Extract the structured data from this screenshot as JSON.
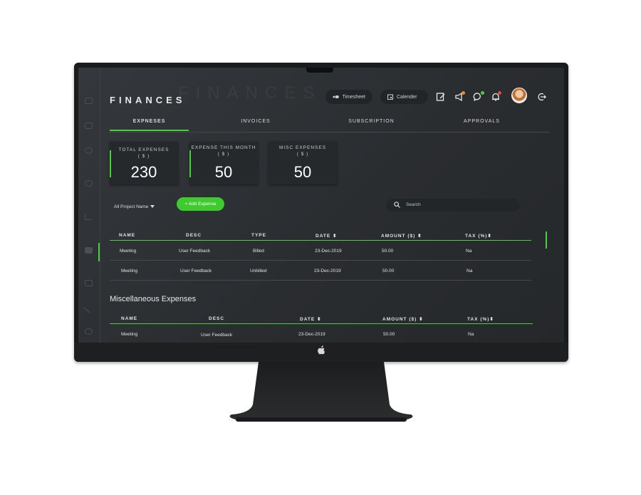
{
  "header": {
    "title": "FINANCES",
    "ghost_title": "FINANCES",
    "timesheet_label": "Timesheet",
    "calendar_label": "Calender"
  },
  "tabs": [
    {
      "label": "EXPNESES",
      "active": true
    },
    {
      "label": "INVOICES",
      "active": false
    },
    {
      "label": "SUBSCRIPTION",
      "active": false
    },
    {
      "label": "APPROVALS",
      "active": false
    }
  ],
  "cards": [
    {
      "label_line1": "TOTAL EXPENSES",
      "label_line2": "( $ )",
      "value": "230"
    },
    {
      "label_line1": "EXPENSE THIS MONTH",
      "label_line2": "( $ )",
      "value": "50"
    },
    {
      "label_line1": "MISC EXPENSES",
      "label_line2": "( $ )",
      "value": "50"
    }
  ],
  "controls": {
    "project_dropdown": "All Project Name",
    "add_expense_label": "+ Add Expense",
    "search_placeholder": "Search"
  },
  "expenses_table": {
    "headers": [
      "NAME",
      "DESC",
      "TYPE",
      "DATE ⬍",
      "AMOUNT ($) ⬍",
      "TAX (%)⬍"
    ],
    "rows": [
      [
        "Meeting",
        "User Feedback",
        "Billed",
        "23-Dec-2019",
        "50.00",
        "Na"
      ],
      [
        "Meeting",
        "User Feedback",
        "Unbilled",
        "23-Dec-2019",
        "50.00",
        "Na"
      ]
    ]
  },
  "misc_section_title": "Miscellaneous Expenses",
  "misc_table": {
    "headers": [
      "NAME",
      "DESC",
      "DATE ⬍",
      "AMOUNT ($) ⬍",
      "TAX (%)⬍"
    ],
    "rows": [
      [
        "Meeting",
        "User Feedback",
        "23-Dec-2019",
        "50.00",
        "Na"
      ]
    ]
  },
  "colors": {
    "accent_green": "#4ccf3c",
    "notification_orange": "#f08a24",
    "notification_green": "#4ccf3c",
    "notification_red": "#e8453c"
  },
  "icons": [
    "timesheet-icon",
    "calendar-icon",
    "edit-note-icon",
    "megaphone-icon",
    "chat-icon",
    "bell-icon",
    "logout-icon",
    "search-icon",
    "caret-down-icon",
    "apple-logo-icon"
  ]
}
